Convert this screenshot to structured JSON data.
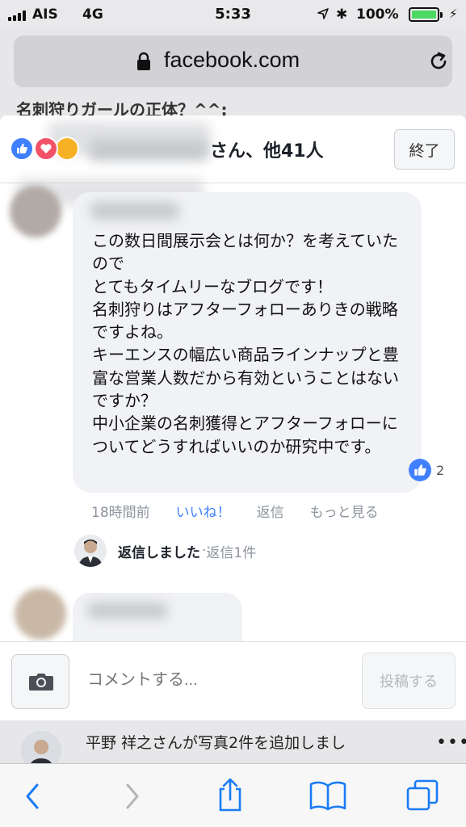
{
  "status_bar": {
    "carrier": "AIS",
    "network": "4G",
    "time": "5:33",
    "battery": "100%",
    "battery_level": 1.0,
    "icons": [
      "signal-icon",
      "location-arrow-icon",
      "bluetooth-icon",
      "battery-icon",
      "charging-bolt-icon"
    ]
  },
  "browser": {
    "url": "facebook.com",
    "icons": [
      "lock-icon",
      "reload-icon"
    ]
  },
  "background_page": {
    "title": "名刺狩りガールの正体？^^:",
    "post_text": "平野 祥之さんが写真2件を追加しまし",
    "more": "•••"
  },
  "modal": {
    "reactors": "さん、他41人",
    "done_label": "終了",
    "comment": {
      "text": "この数日間展示会とは何か？を考えていたので\nとてもタイムリーなブログです！\n名刺狩りはアフターフォローありきの戦略ですよね。\nキーエンスの幅広い商品ラインナップと豊富な営業人数だから有効ということはないですか？\n中小企業の名刺獲得とアフターフォローについてどうすればいいのか研究中です。",
      "like_count": "2",
      "time": "18時間前",
      "like_action": "いいね！",
      "reply_action": "返信",
      "more_action": "もっと見る"
    },
    "reply": {
      "label": "返信しました",
      "separator": " · ",
      "count": "返信1件"
    },
    "composer": {
      "placeholder": "コメントする...",
      "post_label": "投稿する"
    }
  },
  "toolbar": {
    "icons": [
      "back-icon",
      "forward-icon",
      "share-icon",
      "bookmarks-icon",
      "tabs-icon"
    ]
  },
  "colors": {
    "accent": "#4080ff",
    "love": "#f25268",
    "battery": "#4cd964",
    "browser_blue": "#1a7cf5"
  }
}
